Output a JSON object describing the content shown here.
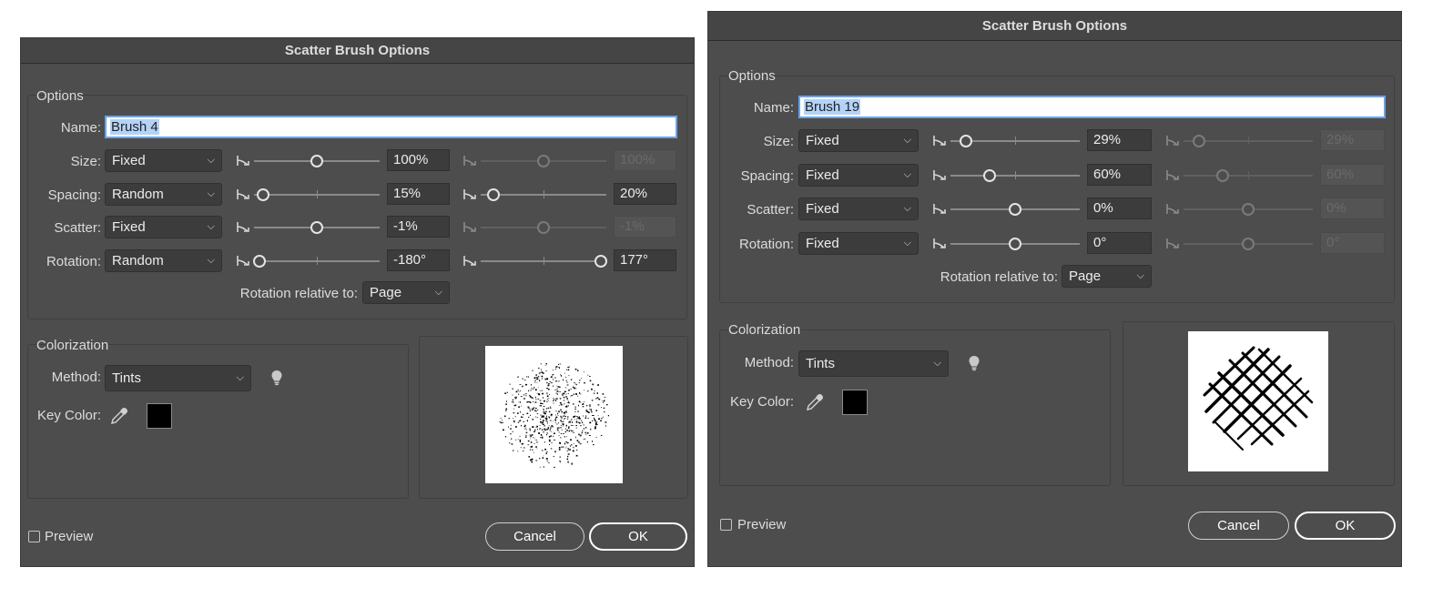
{
  "dialog1": {
    "title": "Scatter Brush Options",
    "options_label": "Options",
    "name_label": "Name:",
    "name_value": "Brush 4",
    "rows": [
      {
        "label": "Size:",
        "method": "Fixed",
        "min_value": "100%",
        "max_value": "100%",
        "min_pos": 0.5,
        "max_pos": 0.5,
        "max_enabled": false
      },
      {
        "label": "Spacing:",
        "method": "Random",
        "min_value": "15%",
        "max_value": "20%",
        "min_pos": 0.07,
        "max_pos": 0.1,
        "max_enabled": true
      },
      {
        "label": "Scatter:",
        "method": "Fixed",
        "min_value": "-1%",
        "max_value": "-1%",
        "min_pos": 0.5,
        "max_pos": 0.5,
        "max_enabled": false
      },
      {
        "label": "Rotation:",
        "method": "Random",
        "min_value": "-180°",
        "max_value": "177°",
        "min_pos": 0.04,
        "max_pos": 0.96,
        "max_enabled": true
      }
    ],
    "rotation_relative_label": "Rotation relative to:",
    "rotation_relative_value": "Page",
    "colorization_label": "Colorization",
    "method_label": "Method:",
    "method_value": "Tints",
    "key_color_label": "Key Color:",
    "key_color": "#000000",
    "preview_label": "Preview",
    "cancel_label": "Cancel",
    "ok_label": "OK"
  },
  "dialog2": {
    "title": "Scatter Brush Options",
    "options_label": "Options",
    "name_label": "Name:",
    "name_value": "Brush 19",
    "rows": [
      {
        "label": "Size:",
        "method": "Fixed",
        "min_value": "29%",
        "max_value": "29%",
        "min_pos": 0.12,
        "max_pos": 0.12,
        "max_enabled": false
      },
      {
        "label": "Spacing:",
        "method": "Fixed",
        "min_value": "60%",
        "max_value": "60%",
        "min_pos": 0.3,
        "max_pos": 0.3,
        "max_enabled": false
      },
      {
        "label": "Scatter:",
        "method": "Fixed",
        "min_value": "0%",
        "max_value": "0%",
        "min_pos": 0.5,
        "max_pos": 0.5,
        "max_enabled": false
      },
      {
        "label": "Rotation:",
        "method": "Fixed",
        "min_value": "0°",
        "max_value": "0°",
        "min_pos": 0.5,
        "max_pos": 0.5,
        "max_enabled": false
      }
    ],
    "rotation_relative_label": "Rotation relative to:",
    "rotation_relative_value": "Page",
    "colorization_label": "Colorization",
    "method_label": "Method:",
    "method_value": "Tints",
    "key_color_label": "Key Color:",
    "key_color": "#000000",
    "preview_label": "Preview",
    "cancel_label": "Cancel",
    "ok_label": "OK"
  },
  "icons": {
    "pressure": "pressure-curve-icon",
    "bulb": "lightbulb-icon",
    "eyedropper": "eyedropper-icon",
    "dropdown_caret": "chevron-down-icon"
  },
  "colors": {
    "dialog_bg": "#4d4d4d",
    "name_focus": "#6aa3e8",
    "selection": "#b4d3f8"
  }
}
